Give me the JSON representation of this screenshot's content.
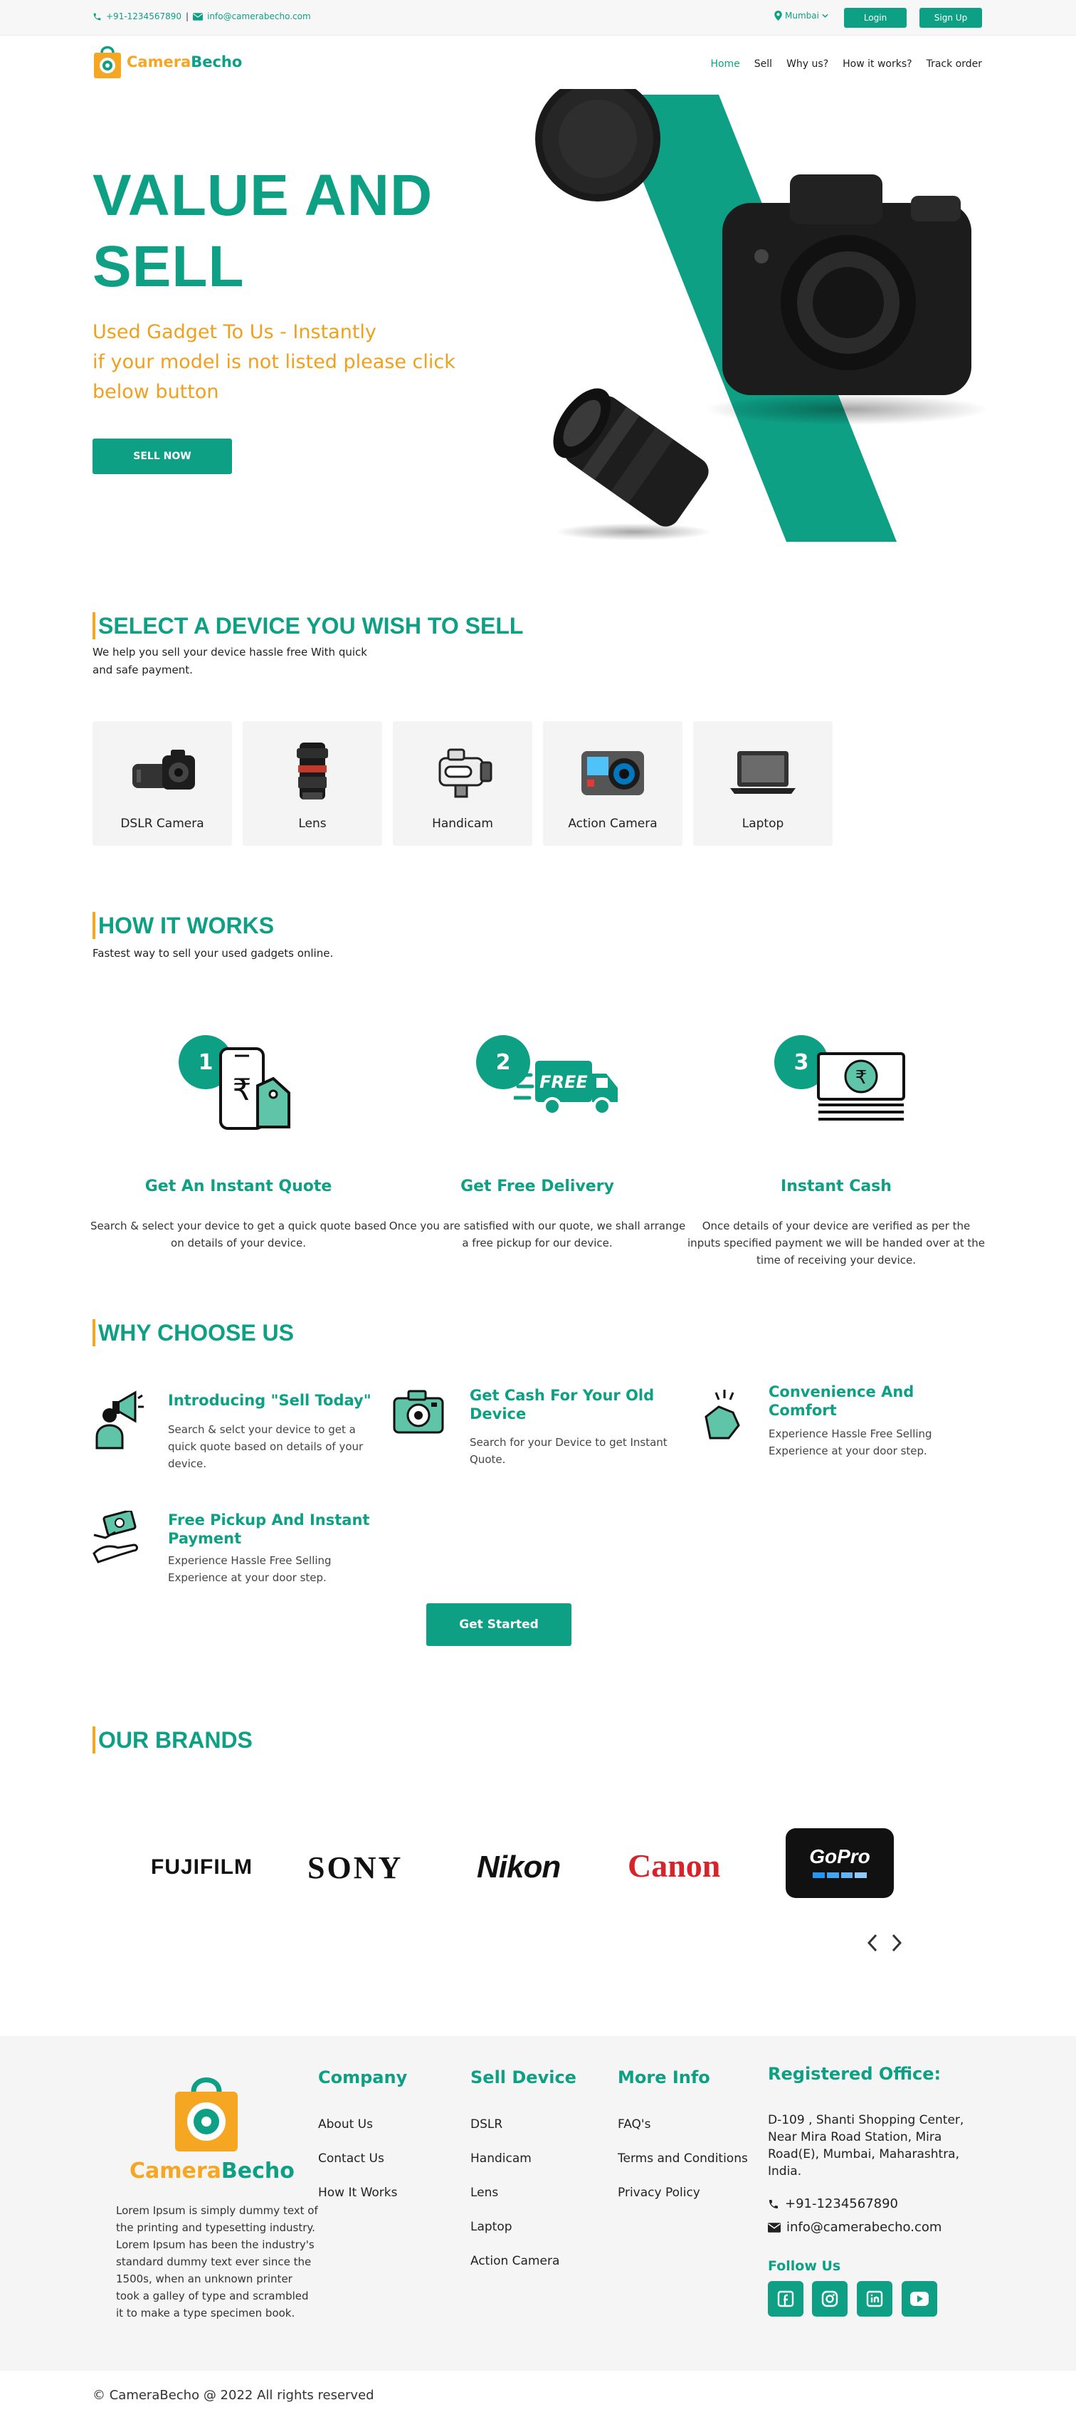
{
  "topbar": {
    "phone": "+91-1234567890",
    "separator": "|",
    "email": "info@camerabecho.com",
    "location": "Mumbai",
    "login_label": "Login",
    "signup_label": "Sign Up"
  },
  "brand": {
    "name_part1": "Camera",
    "name_part2": "Becho"
  },
  "nav": {
    "items": [
      "Home",
      "Sell",
      "Why us?",
      "How it works?",
      "Track order"
    ]
  },
  "hero": {
    "title_line1": "VALUE AND",
    "title_line2": "SELL",
    "subtitle_line1": "Used Gadget To Us - Instantly",
    "subtitle_line2": "if your model is not listed please click",
    "subtitle_line3": "below button",
    "cta": "SELL NOW"
  },
  "select_device": {
    "heading": "SELECT A DEVICE YOU WISH TO SELL",
    "sub_line1": "We help you sell your device hassle free With quick",
    "sub_line2": "and safe payment.",
    "devices": [
      "DSLR Camera",
      "Lens",
      "Handicam",
      "Action Camera",
      "Laptop"
    ]
  },
  "how_it_works": {
    "heading": "HOW IT WORKS",
    "sub": "Fastest way to sell your used gadgets online.",
    "steps": [
      {
        "num": "1",
        "title": "Get An Instant Quote",
        "desc": "Search & select your device to get a quick quote based on details of your device."
      },
      {
        "num": "2",
        "title": "Get Free Delivery",
        "desc": "Once you are satisfied with our quote, we shall arrange a free pickup for our device.",
        "badge": "FREE"
      },
      {
        "num": "3",
        "title": "Instant Cash",
        "desc": "Once details of your device are verified as per the inputs specified payment we will be handed over at the time of receiving your device.",
        "currency": "₹"
      }
    ]
  },
  "why_choose": {
    "heading": "WHY CHOOSE US",
    "items": [
      {
        "title": "Introducing \"Sell Today\"",
        "desc": "Search & selct your device to get a quick quote based on details of your device."
      },
      {
        "title": "Get Cash For Your Old Device",
        "desc": "Search for your Device to get Instant Quote."
      },
      {
        "title": "Convenience And Comfort",
        "desc": "Experience Hassle Free Selling Experience at your door step."
      },
      {
        "title": "Free Pickup And Instant Payment",
        "desc": "Experience Hassle Free Selling Experience at your door step."
      }
    ],
    "cta": "Get Started"
  },
  "brands": {
    "heading": "OUR BRANDS",
    "items": [
      "FUJIFILM",
      "SONY",
      "Nikon",
      "Canon",
      "GoPro"
    ]
  },
  "footer": {
    "about": "Lorem Ipsum is simply dummy text of the printing and typesetting industry. Lorem Ipsum has been the industry's standard dummy text ever since the 1500s, when an unknown printer took a galley of type and scrambled it to make a type specimen book.",
    "company": {
      "heading": "Company",
      "links": [
        "About Us",
        "Contact Us",
        "How It Works"
      ]
    },
    "sell_device": {
      "heading": "Sell Device",
      "links": [
        "DSLR",
        "Handicam",
        "Lens",
        "Laptop",
        "Action Camera"
      ]
    },
    "more_info": {
      "heading": "More Info",
      "links": [
        "FAQ's",
        "Terms and Conditions",
        "Privacy Policy"
      ]
    },
    "office": {
      "heading": "Registered Office:",
      "address": "D-109 , Shanti Shopping Center, Near Mira Road Station, Mira Road(E), Mumbai, Maharashtra, India.",
      "phone": "+91-1234567890",
      "email": "info@camerabecho.com"
    },
    "follow_heading": "Follow Us",
    "copyright": "© CameraBecho @ 2022 All rights reserved"
  },
  "colors": {
    "accent": "#0ea085",
    "brand_orange": "#f5a623",
    "subtitle_orange": "#f0a01e"
  }
}
